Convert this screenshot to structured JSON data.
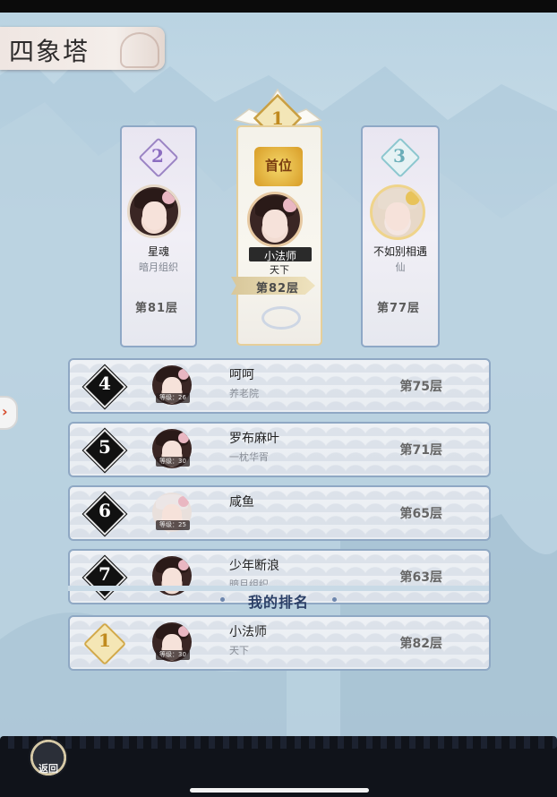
{
  "title": "四象塔",
  "podium": [
    {
      "rank": "2",
      "name": "星魂",
      "guild": "暗月组织",
      "floor": "第81层",
      "rank_color": "#9b84c4"
    },
    {
      "rank": "1",
      "name": "小法师",
      "guild": "天下",
      "floor": "第82层",
      "rank_color": "#d7ad4c"
    },
    {
      "rank": "3",
      "name": "不如别相遇",
      "guild": "仙",
      "floor": "第77层",
      "rank_color": "#8cc7cf"
    }
  ],
  "rankings": [
    {
      "rank": "4",
      "name": "呵呵",
      "guild": "养老院",
      "level": "等级：26",
      "floor": "第75层"
    },
    {
      "rank": "5",
      "name": "罗布麻叶",
      "guild": "一枕华胥",
      "level": "等级：30",
      "floor": "第71层"
    },
    {
      "rank": "6",
      "name": "咸鱼",
      "guild": "",
      "level": "等级：25",
      "floor": "第65层"
    },
    {
      "rank": "7",
      "name": "少年断浪",
      "guild": "暗月组织",
      "level": "",
      "floor": "第63层"
    }
  ],
  "my_rank_label": "我的排名",
  "my_rank": {
    "rank": "1",
    "name": "小法师",
    "guild": "天下",
    "level": "等级：30",
    "floor": "第82层"
  },
  "back_label": "返回",
  "first_badge": "首位"
}
